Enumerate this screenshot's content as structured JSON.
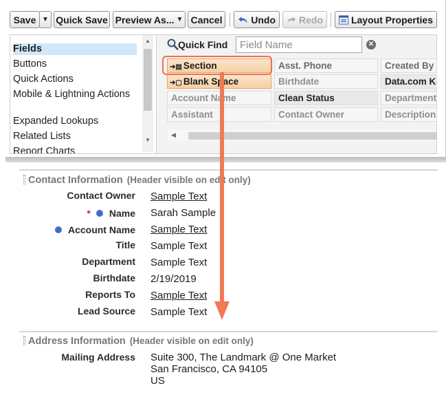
{
  "toolbar": {
    "save": "Save",
    "quick_save": "Quick Save",
    "preview_as": "Preview As...",
    "cancel": "Cancel",
    "undo": "Undo",
    "redo": "Redo",
    "layout_properties": "Layout Properties"
  },
  "palette": {
    "categories": [
      "Fields",
      "Buttons",
      "Quick Actions",
      "Mobile & Lightning Actions",
      "Expanded Lookups",
      "Related Lists",
      "Report Charts"
    ],
    "selected_category": "Fields",
    "quick_find_label": "Quick Find",
    "quick_find_placeholder": "Field Name",
    "fields": {
      "section": "Section",
      "blank_space": "Blank Space",
      "account_name": "Account Name",
      "assistant": "Assistant",
      "asst_phone": "Asst. Phone",
      "birthdate": "Birthdate",
      "clean_status": "Clean Status",
      "contact_owner": "Contact Owner",
      "created_by": "Created By",
      "datacom_key": "Data.com Key",
      "department": "Department",
      "description": "Description"
    }
  },
  "contact_section": {
    "title": "Contact Information",
    "note": "(Header visible on edit only)",
    "fields": [
      {
        "label": "Contact Owner",
        "value": "Sample Text"
      },
      {
        "label": "Name",
        "value": "Sarah Sample"
      },
      {
        "label": "Account Name",
        "value": "Sample Text"
      },
      {
        "label": "Title",
        "value": "Sample Text"
      },
      {
        "label": "Department",
        "value": "Sample Text"
      },
      {
        "label": "Birthdate",
        "value": "2/19/2019"
      },
      {
        "label": "Reports To",
        "value": "Sample Text"
      },
      {
        "label": "Lead Source",
        "value": "Sample Text"
      }
    ]
  },
  "address_section": {
    "title": "Address Information",
    "note": "(Header visible on edit only)",
    "mailing_label": "Mailing Address",
    "mailing_lines": [
      "Suite 300, The Landmark @ One Market",
      "San Francisco, CA 94105",
      "US"
    ]
  },
  "colors": {
    "accent": "#f07a55",
    "selected_category_bg": "#cfe7f8",
    "required": "#d9262a",
    "info_dot": "#3f6ec9"
  }
}
